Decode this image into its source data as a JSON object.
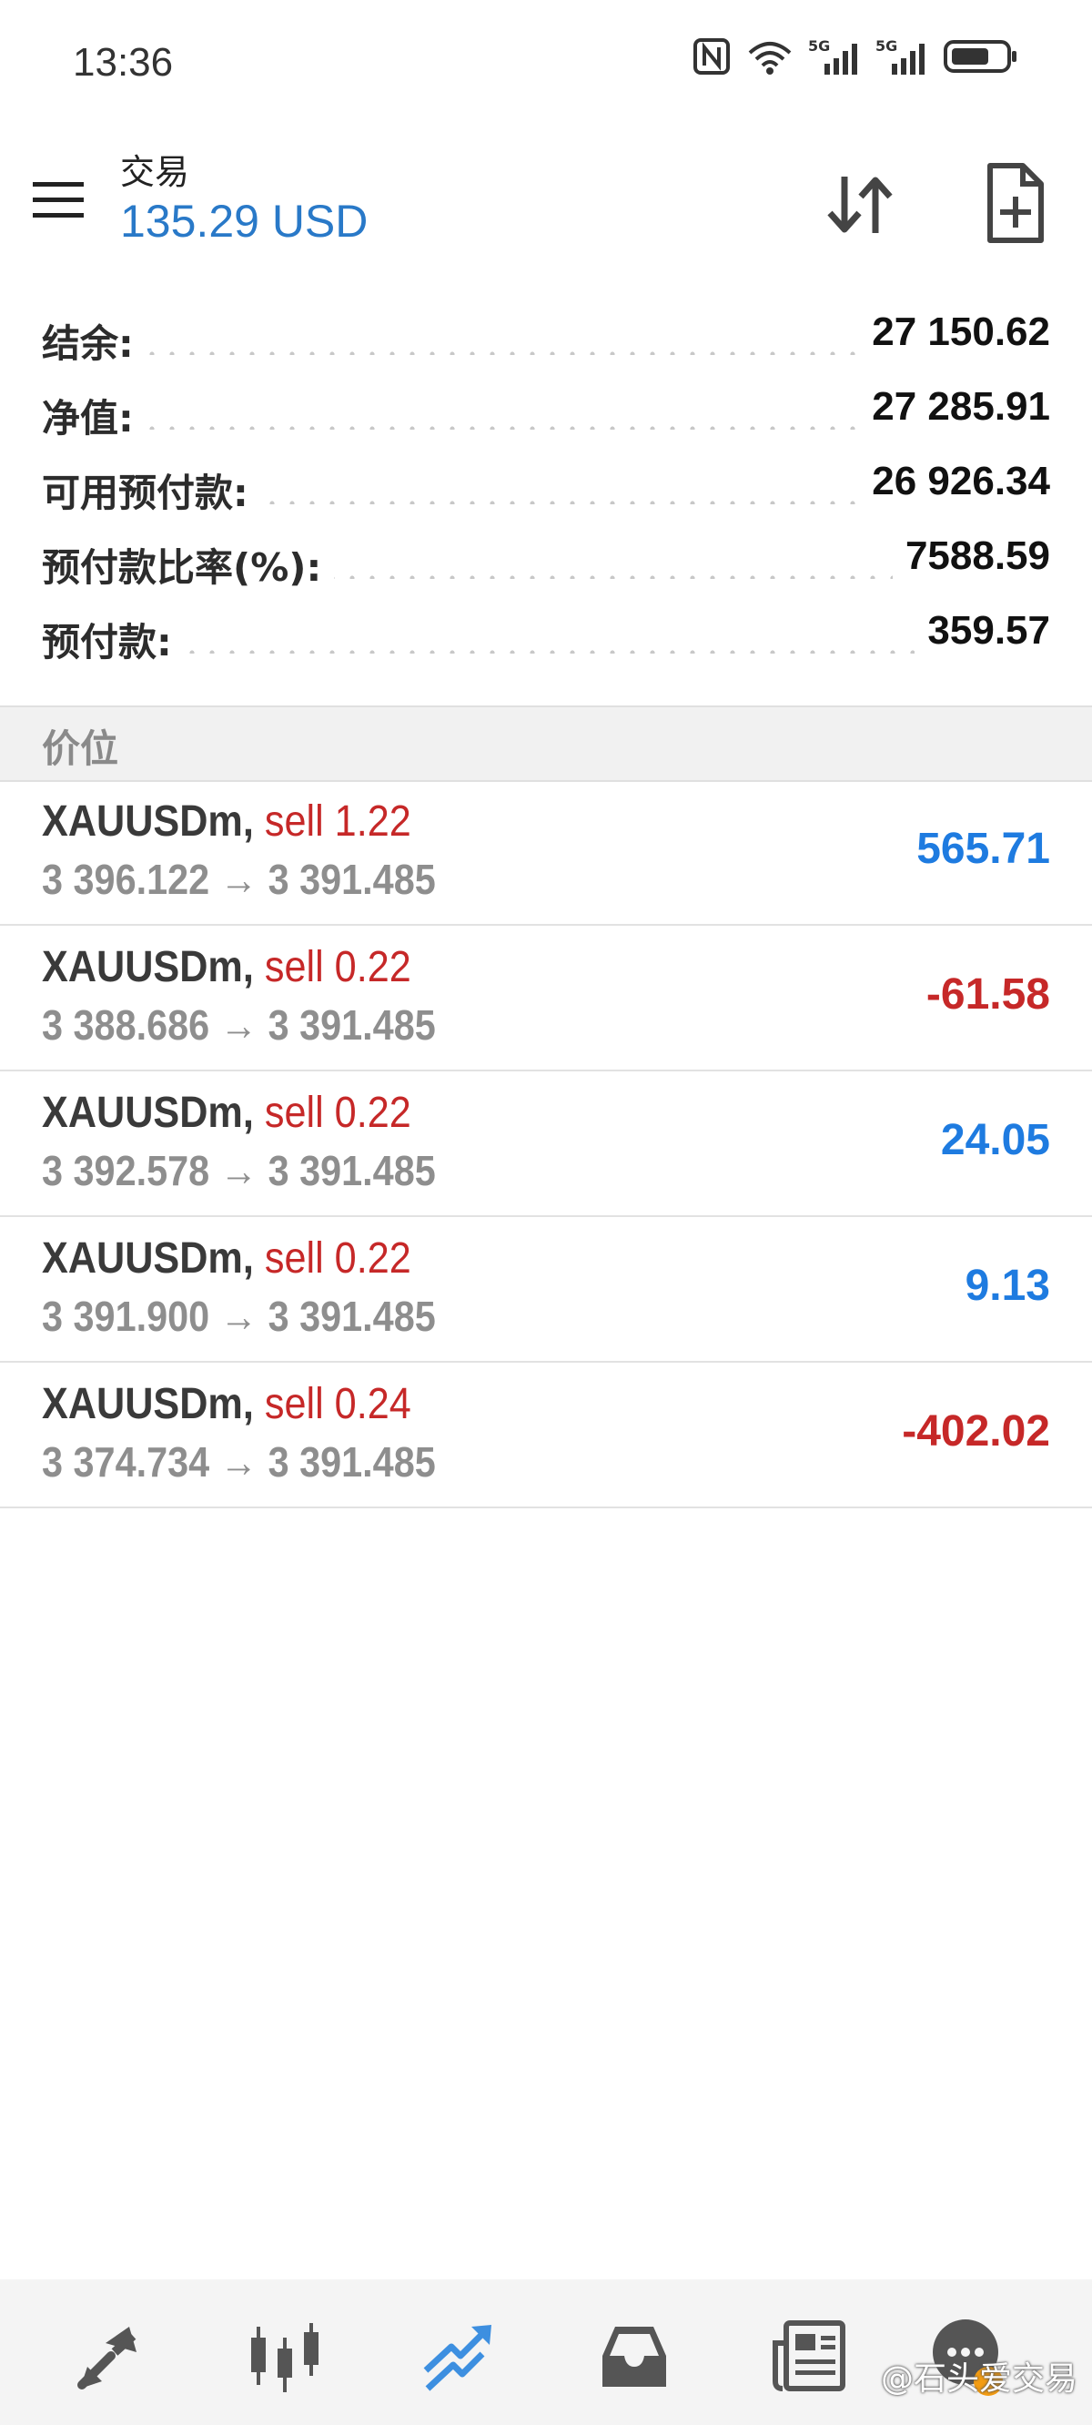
{
  "status_bar": {
    "time": "13:36"
  },
  "header": {
    "title": "交易",
    "balance": "135.29 USD"
  },
  "summary": [
    {
      "label": "结余:",
      "value": "27 150.62"
    },
    {
      "label": "净值:",
      "value": "27 285.91"
    },
    {
      "label": "可用预付款:",
      "value": "26 926.34"
    },
    {
      "label": "预付款比率(%):",
      "value": "7588.59"
    },
    {
      "label": "预付款:",
      "value": "359.57"
    }
  ],
  "section_title": "价位",
  "positions": [
    {
      "symbol": "XAUUSDm,",
      "side": "sell 1.22",
      "prices": "3 396.122 → 3 391.485",
      "profit": "565.71"
    },
    {
      "symbol": "XAUUSDm,",
      "side": "sell 0.22",
      "prices": "3 388.686 → 3 391.485",
      "profit": "-61.58"
    },
    {
      "symbol": "XAUUSDm,",
      "side": "sell 0.22",
      "prices": "3 392.578 → 3 391.485",
      "profit": "24.05"
    },
    {
      "symbol": "XAUUSDm,",
      "side": "sell 0.22",
      "prices": "3 391.900 → 3 391.485",
      "profit": "9.13"
    },
    {
      "symbol": "XAUUSDm,",
      "side": "sell 0.24",
      "prices": "3 374.734 → 3 391.485",
      "profit": "-402.02"
    }
  ],
  "bottom_nav": {
    "items": [
      "quotes-icon",
      "chart-icon",
      "trade-icon",
      "history-icon",
      "news-icon",
      "chat-icon"
    ],
    "active": "trade-icon"
  },
  "watermark": "@石头爱交易",
  "colors": {
    "accent": "#2979c8",
    "positive": "#1e7be0",
    "negative": "#c62828"
  }
}
